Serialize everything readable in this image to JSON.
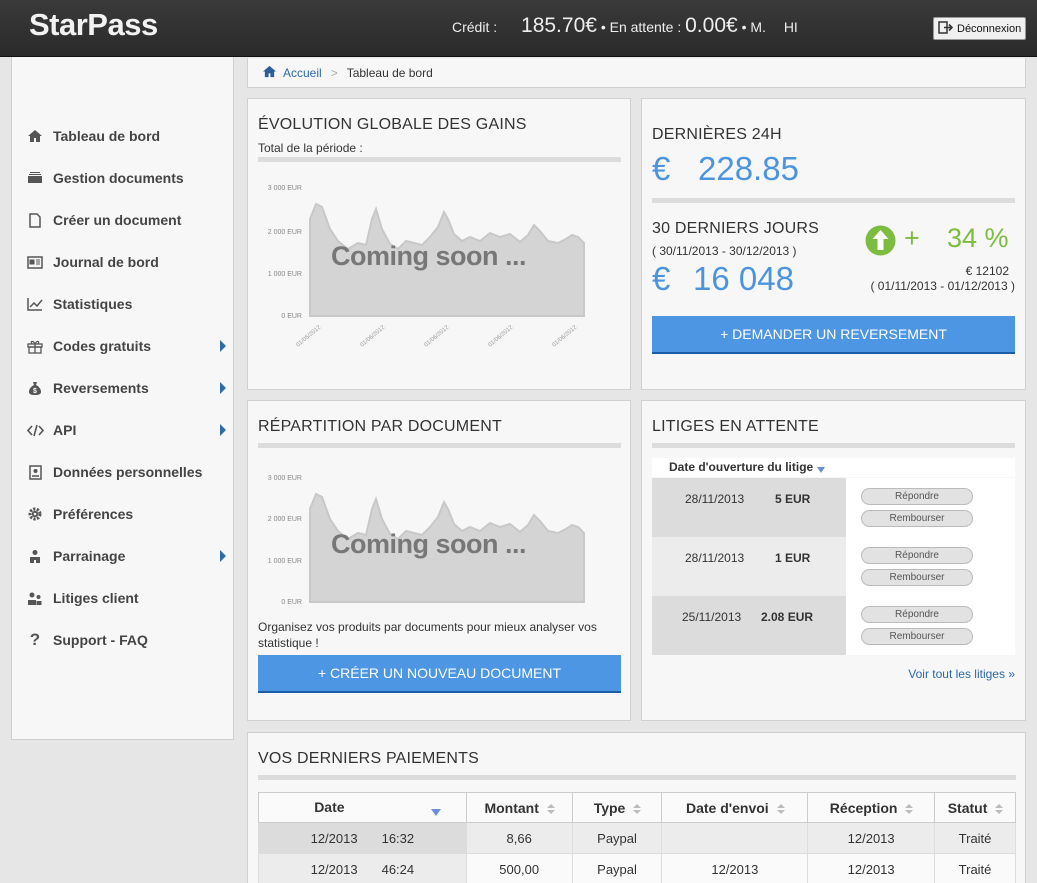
{
  "header": {
    "logo": "StarPass",
    "credit_label": "Crédit :",
    "credit_value": "185.70€",
    "pending_label": "• En attente :",
    "pending_value": "0.00€",
    "user": "• M.",
    "user_name": "HI",
    "logout_label": "Déconnexion"
  },
  "breadcrumb": {
    "home": "Accueil",
    "separator": ">",
    "current": "Tableau de bord"
  },
  "sidebar": {
    "items": [
      {
        "label": "Tableau de bord",
        "icon": "home-icon"
      },
      {
        "label": "Gestion documents",
        "icon": "documents-icon"
      },
      {
        "label": "Créer un document",
        "icon": "new-document-icon"
      },
      {
        "label": "Journal de bord",
        "icon": "journal-icon"
      },
      {
        "label": "Statistiques",
        "icon": "chart-icon"
      },
      {
        "label": "Codes gratuits",
        "icon": "gift-icon"
      },
      {
        "label": "Reversements",
        "icon": "money-bag-icon"
      },
      {
        "label": "API",
        "icon": "code-icon"
      },
      {
        "label": "Données personnelles",
        "icon": "id-card-icon"
      },
      {
        "label": "Préférences",
        "icon": "gear-icon"
      },
      {
        "label": "Parrainage",
        "icon": "referral-icon"
      },
      {
        "label": "Litiges client",
        "icon": "users-icon"
      },
      {
        "label": "Support - FAQ",
        "icon": "question-icon"
      }
    ]
  },
  "evolution": {
    "title": "ÉVOLUTION GLOBALE DES GAINS",
    "subtitle": "Total de la période :",
    "overlay": "Coming soon ...",
    "y_ticks": [
      "3 000 EUR",
      "2 000 EUR",
      "1 000 EUR",
      "0 EUR"
    ],
    "x_ticks": [
      "01/05/2012",
      "01/06/2012",
      "01/06/2012",
      "01/06/2012",
      "01/06/2012"
    ]
  },
  "last24": {
    "title": "DERNIÈRES 24H",
    "currency": "€",
    "value": "228.85",
    "month_title": "30 DERNIERS JOURS",
    "month_range": "( 30/11/2013 - 30/12/2013 )",
    "month_value": "16 048",
    "growth_plus": "+",
    "growth_value": "34 %",
    "prev_value": "€ 12102",
    "prev_range": "( 01/11/2013 - 01/12/2013 )",
    "button": "+ DEMANDER UN REVERSEMENT",
    "colors": {
      "accent": "#4c95de",
      "growth": "#7cbc3f"
    }
  },
  "repartition": {
    "title": "RÉPARTITION PAR DOCUMENT",
    "overlay": "Coming soon ...",
    "y_ticks": [
      "3 000 EUR",
      "2 000 EUR",
      "1 000 EUR",
      "0 EUR"
    ],
    "text": "Organisez vos produits par documents pour mieux analyser vos statistique !",
    "button": "+ CRÉER UN NOUVEAU DOCUMENT"
  },
  "litiges": {
    "title": "LITIGES EN ATTENTE",
    "column": "Date d'ouverture du litige",
    "rows": [
      {
        "date": "28/11/2013",
        "amount": "5 EUR"
      },
      {
        "date": "28/11/2013",
        "amount": "1 EUR"
      },
      {
        "date": "25/11/2013",
        "amount": "2.08 EUR"
      }
    ],
    "reply_label": "Répondre",
    "refund_label": "Rembourser",
    "see_all": "Voir tout les litiges »"
  },
  "payments": {
    "title": "VOS DERNIERS PAIEMENTS",
    "columns": [
      "Date",
      "Montant",
      "Type",
      "Date d'envoi",
      "Réception",
      "Statut"
    ],
    "rows": [
      {
        "date": "12/2013",
        "time": "16:32",
        "amount": "8,66",
        "type": "Paypal",
        "sent": "",
        "received": "12/2013",
        "status": "Traité"
      },
      {
        "date": "12/2013",
        "time": "46:24",
        "amount": "500,00",
        "type": "Paypal",
        "sent": "12/2013",
        "received": "12/2013",
        "status": "Traité"
      }
    ]
  }
}
